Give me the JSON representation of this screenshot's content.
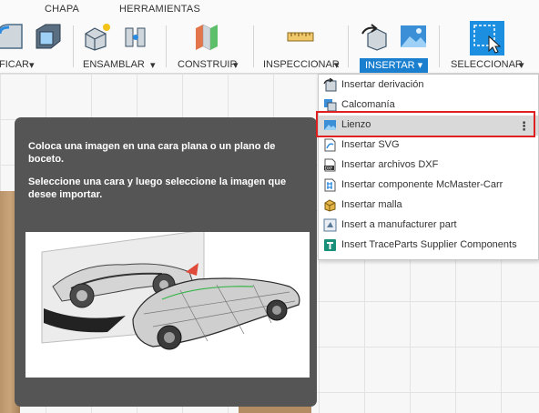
{
  "tabs": [
    "CHAPA",
    "HERRAMIENTAS"
  ],
  "groups": {
    "modify": "FICAR",
    "assemble": "ENSAMBLAR",
    "construct": "CONSTRUIR",
    "inspect": "INSPECCIONAR",
    "insert": "INSERTAR",
    "select": "SELECCIONAR"
  },
  "colors": {
    "accent": "#1b7fd0",
    "highlight": "#e02020",
    "panel": "#555556"
  },
  "tooltip": {
    "line1": "Coloca una imagen en una cara plana o un plano de boceto.",
    "line2": "Seleccione una cara y luego seleccione la imagen que desee importar."
  },
  "menu": [
    {
      "label": "Insertar derivación",
      "icon": "derive-icon"
    },
    {
      "label": "Calcomanía",
      "icon": "decal-icon"
    },
    {
      "label": "Lienzo",
      "icon": "canvas-image-icon",
      "highlighted": true
    },
    {
      "label": "Insertar SVG",
      "icon": "svg-icon"
    },
    {
      "label": "Insertar archivos DXF",
      "icon": "dxf-icon"
    },
    {
      "label": "Insertar componente McMaster-Carr",
      "icon": "mcmaster-icon"
    },
    {
      "label": "Insertar malla",
      "icon": "mesh-icon"
    },
    {
      "label": "Insert a manufacturer part",
      "icon": "manufacturer-part-icon"
    },
    {
      "label": "Insert TraceParts Supplier Components",
      "icon": "traceparts-icon"
    }
  ]
}
